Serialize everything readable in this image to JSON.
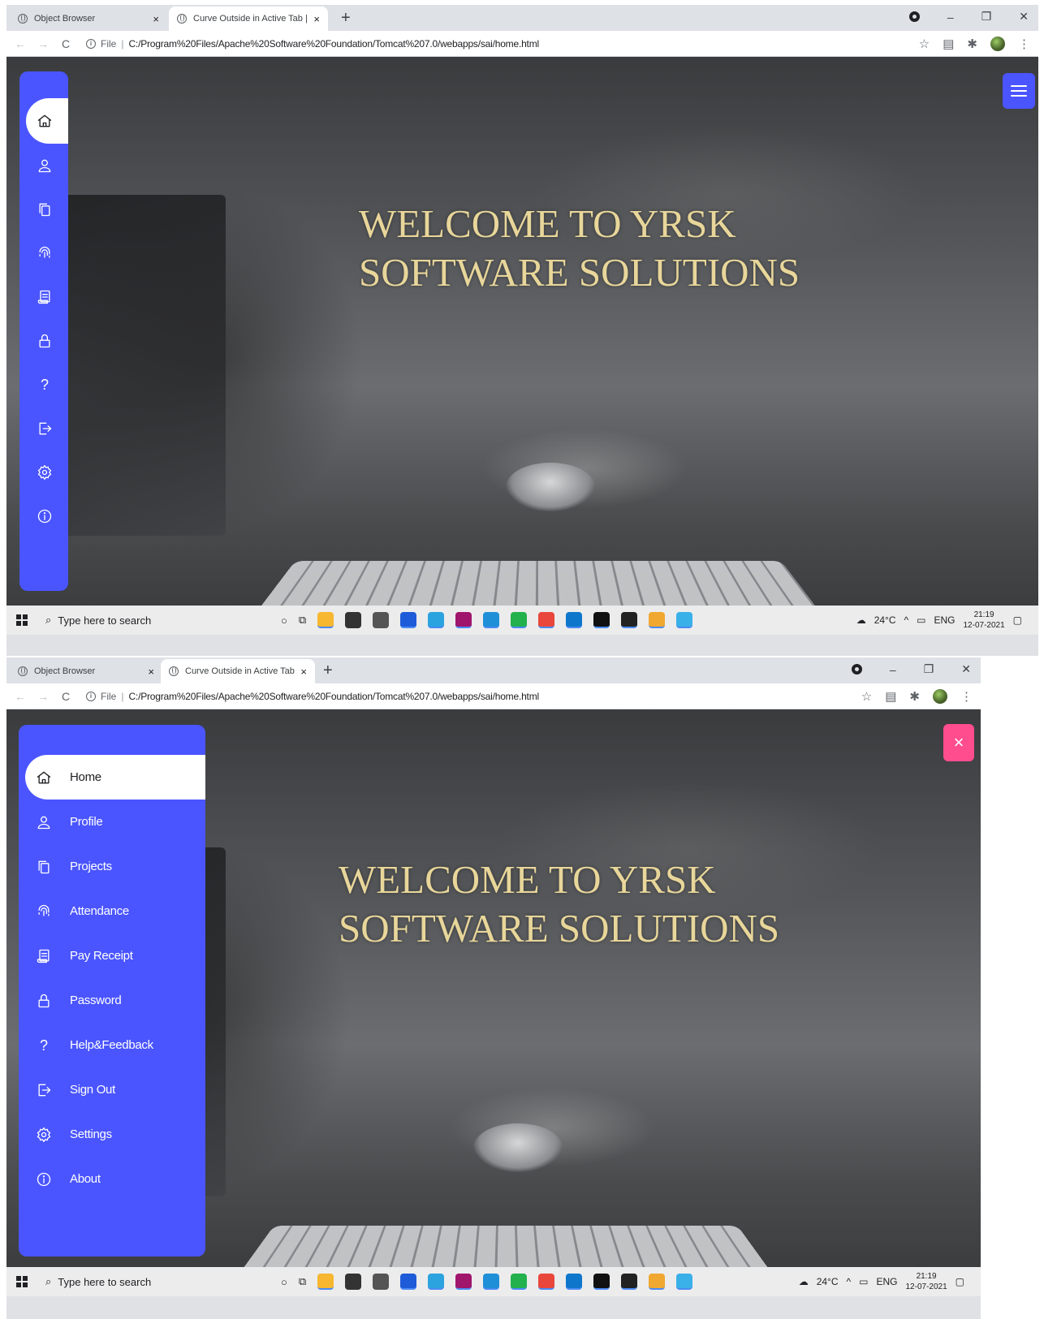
{
  "browser": {
    "tabs": [
      {
        "label": "Object Browser",
        "close": "×"
      },
      {
        "label": "Curve Outside in Active Tab | Sidi",
        "close": "×"
      }
    ],
    "new_tab": "+",
    "url_scheme": "File",
    "url": "C:/Program%20Files/Apache%20Software%20Foundation/Tomcat%207.0/webapps/sai/home.html"
  },
  "page": {
    "headline_line1": "WELCOME TO YRSK",
    "headline_line2": "SOFTWARE SOLUTIONS"
  },
  "sidebar": {
    "items": [
      {
        "label": "Home",
        "icon": "home-icon"
      },
      {
        "label": "Profile",
        "icon": "user-icon"
      },
      {
        "label": "Projects",
        "icon": "copy-icon"
      },
      {
        "label": "Attendance",
        "icon": "fingerprint-icon"
      },
      {
        "label": "Pay Receipt",
        "icon": "receipt-icon"
      },
      {
        "label": "Password",
        "icon": "lock-icon"
      },
      {
        "label": "Help&Feedback",
        "icon": "help-icon"
      },
      {
        "label": "Sign Out",
        "icon": "sign-out-icon"
      },
      {
        "label": "Settings",
        "icon": "gear-icon"
      },
      {
        "label": "About",
        "icon": "info-icon"
      }
    ],
    "active": "Home",
    "accent": "#4a55ff"
  },
  "controls": {
    "close_glyph": "×",
    "close_color": "#ff4d8d"
  },
  "taskbar": {
    "search_placeholder": "Type here to search",
    "weather": "24°C",
    "lang": "ENG",
    "time": "21:19",
    "date": "12-07-2021"
  }
}
